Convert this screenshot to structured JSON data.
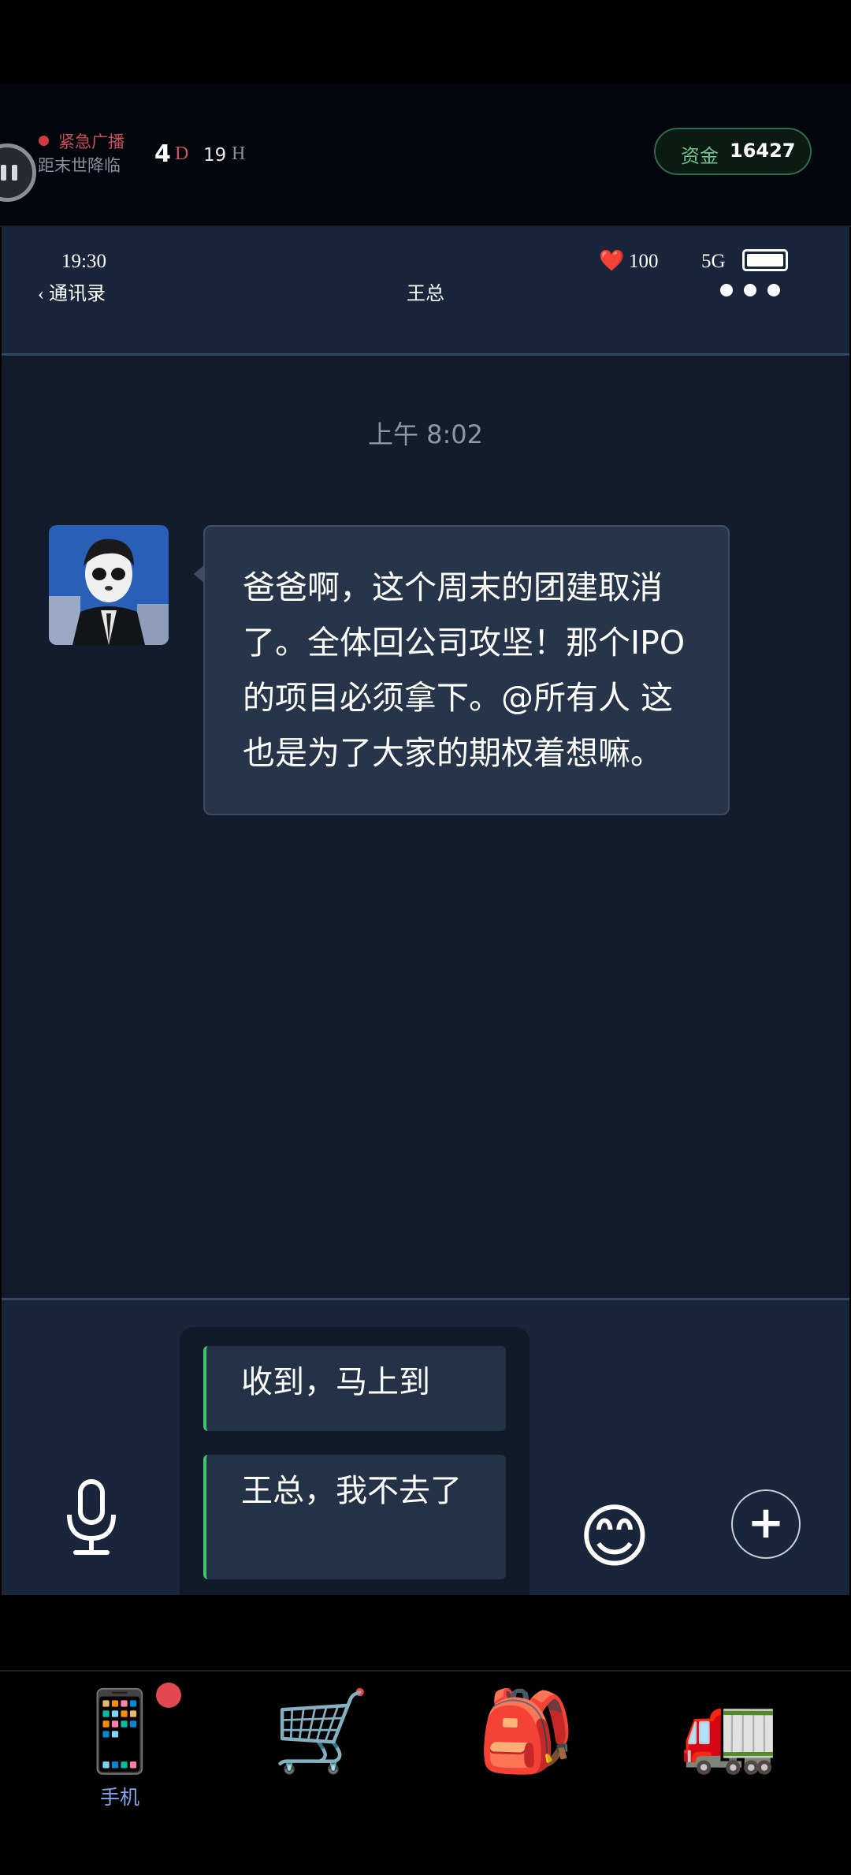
{
  "hud": {
    "alert_label": "紧急广播",
    "countdown_label": "距末世降临",
    "days": "4",
    "days_unit": "D",
    "hours": "19",
    "hours_unit": "H",
    "funds_label": "资金",
    "funds_value": "16427"
  },
  "phone": {
    "status": {
      "time": "19:30",
      "health_icon": "❤️",
      "health": "100",
      "network": "5G"
    },
    "back_label": "通讯录",
    "contact_name": "王总"
  },
  "chat": {
    "timestamp": "上午 8:02",
    "message": "爸爸啊，这个周末的团建取消了。全体回公司攻坚！那个IPO的项目必须拿下。@所有人 这也是为了大家的期权着想嘛。"
  },
  "replies": [
    {
      "text": "收到，马上到"
    },
    {
      "text": "王总，我不去了"
    }
  ],
  "input": {
    "emoji": "😊",
    "plus": "+"
  },
  "nav": {
    "items": [
      {
        "icon": "📱",
        "label": "手机",
        "active": true
      },
      {
        "icon": "🛒"
      },
      {
        "icon": "🎒"
      },
      {
        "icon": "🚛"
      }
    ]
  },
  "colors": {
    "accent_green": "#3ec26a",
    "alert_red": "#d23b45",
    "funds_green": "#6ec48f",
    "nav_active": "#7fa5e8"
  }
}
